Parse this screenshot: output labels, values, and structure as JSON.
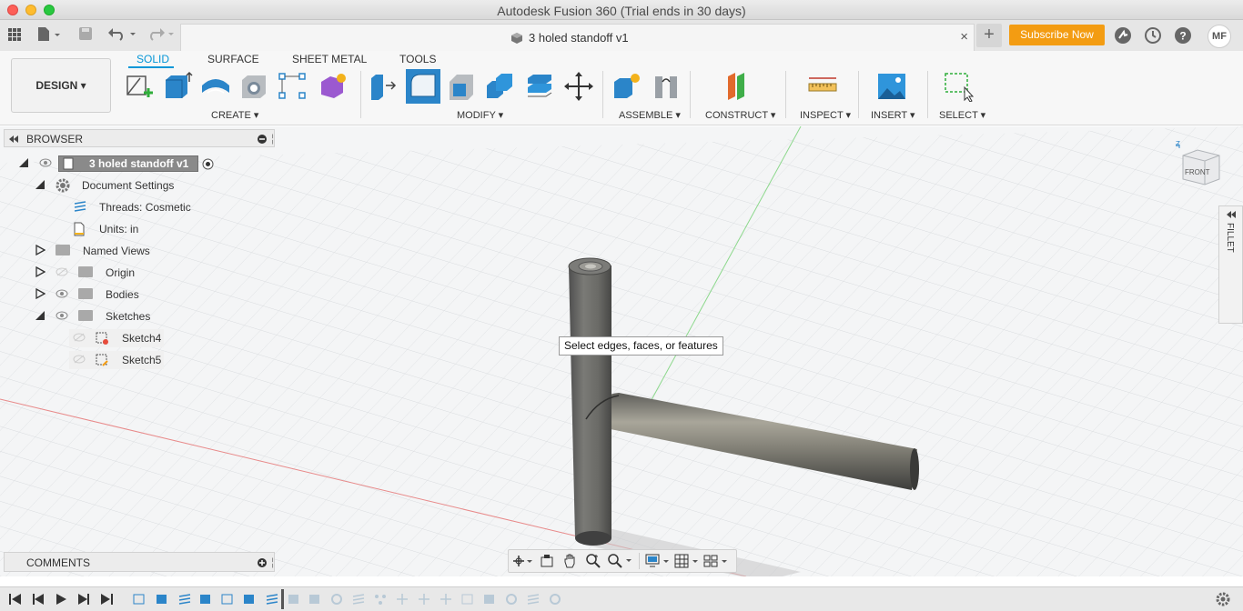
{
  "window": {
    "title": "Autodesk Fusion 360 (Trial ends in 30 days)"
  },
  "document_tab": {
    "name": "3 holed standoff v1",
    "close_glyph": "×"
  },
  "header": {
    "subscribe_label": "Subscribe Now",
    "new_tab_glyph": "+",
    "avatar_initials": "MF"
  },
  "toolbar": {
    "workspace_label": "DESIGN ▾",
    "tabs": [
      "SOLID",
      "SURFACE",
      "SHEET METAL",
      "TOOLS"
    ],
    "active_tab": "SOLID",
    "groups": {
      "create": "CREATE ▾",
      "modify": "MODIFY ▾",
      "assemble": "ASSEMBLE ▾",
      "construct": "CONSTRUCT ▾",
      "inspect": "INSPECT ▾",
      "insert": "INSERT ▾",
      "select": "SELECT ▾"
    }
  },
  "browser": {
    "title": "BROWSER",
    "items": [
      {
        "label": "3 holed standoff v1"
      },
      {
        "label": "Document Settings"
      },
      {
        "label": "Threads: Cosmetic"
      },
      {
        "label": "Units: in"
      },
      {
        "label": "Named Views"
      },
      {
        "label": "Origin"
      },
      {
        "label": "Bodies"
      },
      {
        "label": "Sketches"
      },
      {
        "label": "Sketch4"
      },
      {
        "label": "Sketch5"
      }
    ]
  },
  "viewport": {
    "tooltip": "Select edges, faces, or features",
    "viewcube_label": "FRONT"
  },
  "fillet_panel": {
    "label": "FILLET"
  },
  "comments": {
    "title": "COMMENTS"
  },
  "colors": {
    "accent": "#0696d7",
    "subscribe": "#f39c12",
    "body": "#6c6c6c"
  }
}
